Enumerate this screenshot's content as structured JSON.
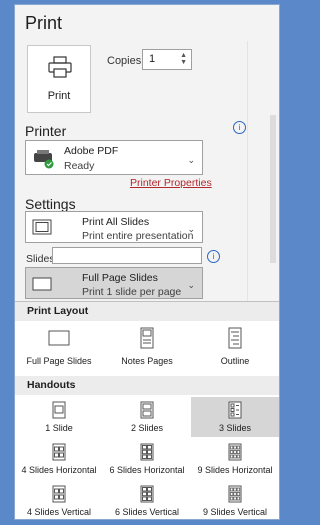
{
  "title": "Print",
  "print_button": {
    "label": "Print",
    "icon": "printer-icon"
  },
  "copies": {
    "label": "Copies:",
    "value": "1"
  },
  "printer": {
    "heading": "Printer",
    "name": "Adobe PDF",
    "status": "Ready",
    "properties_link": "Printer Properties"
  },
  "settings": {
    "heading": "Settings",
    "range": {
      "title": "Print All Slides",
      "subtitle": "Print entire presentation"
    },
    "slides_label": "Slides:",
    "slides_value": "",
    "layout": {
      "title": "Full Page Slides",
      "subtitle": "Print 1 slide per page"
    }
  },
  "flyout": {
    "print_layout": {
      "heading": "Print Layout",
      "options": [
        "Full Page Slides",
        "Notes Pages",
        "Outline"
      ]
    },
    "handouts": {
      "heading": "Handouts",
      "options": [
        "1 Slide",
        "2 Slides",
        "3 Slides",
        "4 Slides Horizontal",
        "6 Slides Horizontal",
        "9 Slides Horizontal",
        "4 Slides Vertical",
        "6 Slides Vertical",
        "9 Slides Vertical"
      ],
      "selected": "3 Slides"
    }
  },
  "colors": {
    "accent": "#2a66c2",
    "link": "#b0282c",
    "frame": "#5a88c8"
  }
}
